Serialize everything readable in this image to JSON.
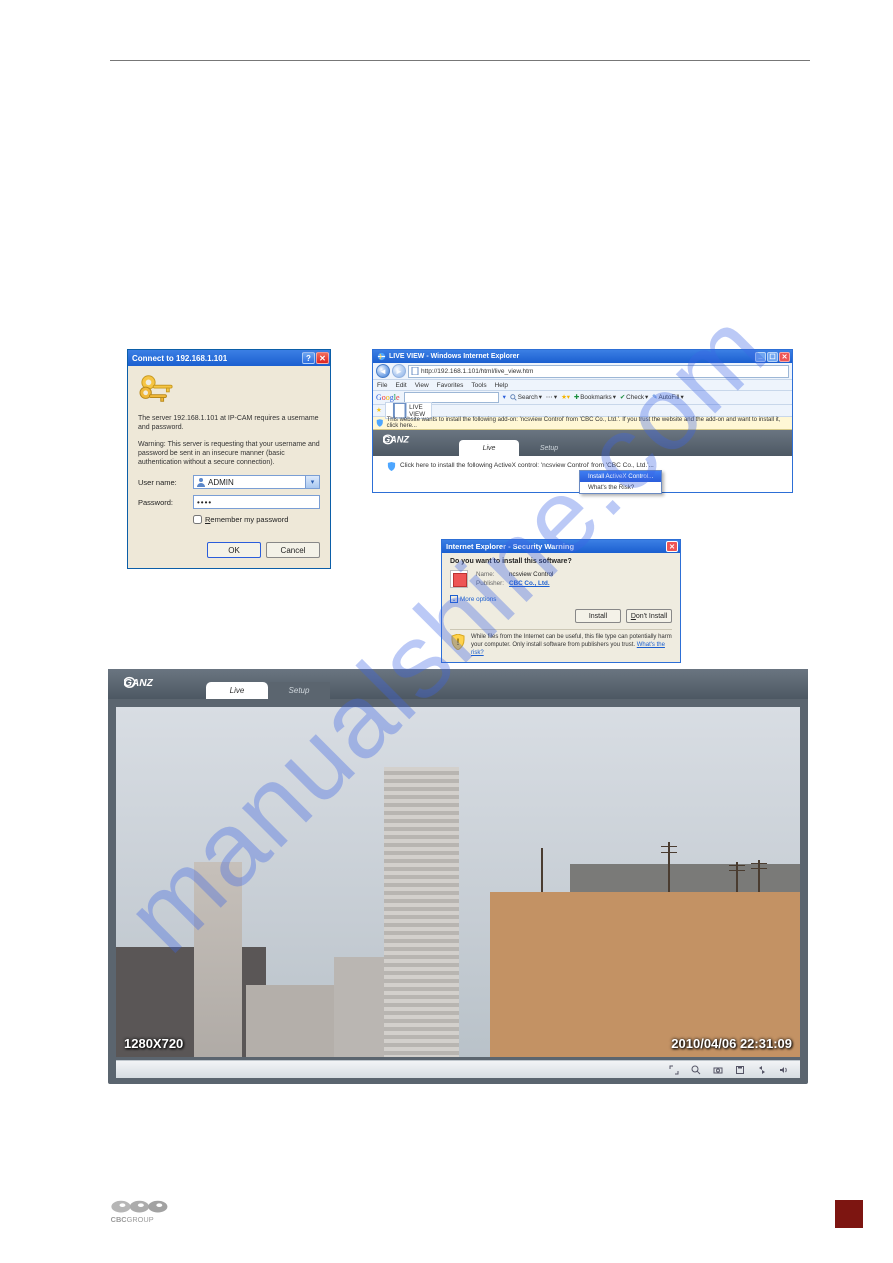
{
  "watermark": "manualshine.com",
  "login": {
    "title": "Connect to 192.168.1.101",
    "server_msg": "The server 192.168.1.101 at IP-CAM requires a username and password.",
    "warning_msg": "Warning: This server is requesting that your username and password be sent in an insecure manner (basic authentication without a secure connection).",
    "user_label": "User name:",
    "user_value": "ADMIN",
    "pwd_label": "Password:",
    "pwd_value": "••••",
    "remember": "Remember my password",
    "ok": "OK",
    "cancel": "Cancel"
  },
  "ie": {
    "title": "LIVE VIEW - Windows Internet Explorer",
    "url": "http://192.168.1.101/html/live_view.htm",
    "menu": [
      "File",
      "Edit",
      "View",
      "Favorites",
      "Tools",
      "Help"
    ],
    "google": {
      "search": "Search",
      "bookmarks": "Bookmarks",
      "check": "Check",
      "autofill": "AutoFill"
    },
    "fav_tab": "LIVE VIEW",
    "infobar": "This website wants to install the following add-on: 'ncsview Control' from 'CBC Co., Ltd.'. If you trust the website and the add-on and want to install it, click here...",
    "activex_hint": "Click here to install the following ActiveX control: 'ncsview Control' from 'CBC Co., Ltd.'...",
    "ax_menu_install": "Install ActiveX Control...",
    "ax_menu_risk": "What's the Risk?",
    "tabs": {
      "live": "Live",
      "setup": "Setup"
    }
  },
  "secwarn": {
    "title": "Internet Explorer - Security Warning",
    "question": "Do you want to install this software?",
    "name_label": "Name:",
    "name_value": "ncsview Control",
    "pub_label": "Publisher:",
    "pub_value": "CBC Co., Ltd.",
    "more": "More options",
    "install": "Install",
    "dont_install": "Don't Install",
    "warning_text": "While files from the Internet can be useful, this file type can potentially harm your computer. Only install software from publishers you trust.",
    "whats_risk": "What's the risk?"
  },
  "live": {
    "tabs": {
      "live": "Live",
      "setup": "Setup"
    },
    "resolution": "1280X720",
    "timestamp": "2010/04/06 22:31:09",
    "toolbar": {
      "expand": "expand",
      "zoom": "zoom",
      "snapshot": "snapshot",
      "record": "record",
      "flip": "flip",
      "audio": "audio"
    }
  },
  "footer_brand": "CBCGROUP"
}
